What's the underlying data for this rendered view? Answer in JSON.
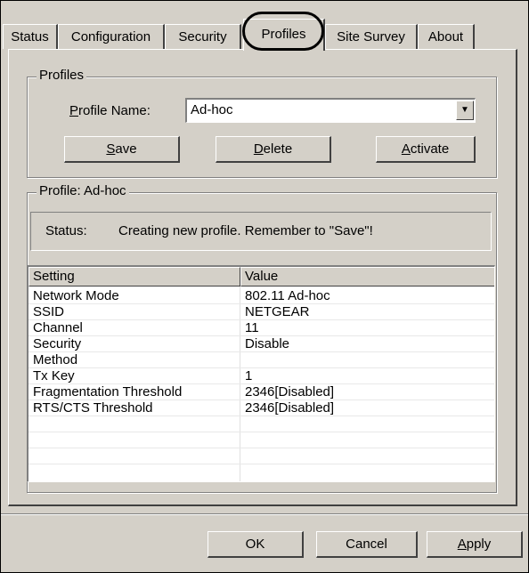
{
  "tabs": [
    {
      "label": "Status"
    },
    {
      "label": "Configuration"
    },
    {
      "label": "Security"
    },
    {
      "label": "Profiles"
    },
    {
      "label": "Site Survey"
    },
    {
      "label": "About"
    }
  ],
  "profiles_group": {
    "title": "Profiles",
    "profile_name_label": "Profile Name:",
    "profile_name_value": "Ad-hoc",
    "save": "Save",
    "delete": "Delete",
    "activate": "Activate"
  },
  "profile_group": {
    "title": "Profile: Ad-hoc",
    "status_label": "Status:",
    "status_text": "Creating new profile. Remember to \"Save\"!"
  },
  "settings_table": {
    "headers": [
      "Setting",
      "Value"
    ],
    "rows": [
      {
        "setting": "Network Mode",
        "value": "802.11 Ad-hoc"
      },
      {
        "setting": "SSID",
        "value": "NETGEAR"
      },
      {
        "setting": "Channel",
        "value": "11"
      },
      {
        "setting": "Security",
        "value": "Disable"
      },
      {
        "setting": "Method",
        "value": ""
      },
      {
        "setting": "Tx Key",
        "value": "1"
      },
      {
        "setting": "Fragmentation Threshold",
        "value": "2346[Disabled]"
      },
      {
        "setting": "RTS/CTS Threshold",
        "value": "2346[Disabled]"
      },
      {
        "setting": "",
        "value": ""
      },
      {
        "setting": "",
        "value": ""
      },
      {
        "setting": "",
        "value": ""
      }
    ]
  },
  "dialog_buttons": {
    "ok": "OK",
    "cancel": "Cancel",
    "apply": "Apply"
  }
}
